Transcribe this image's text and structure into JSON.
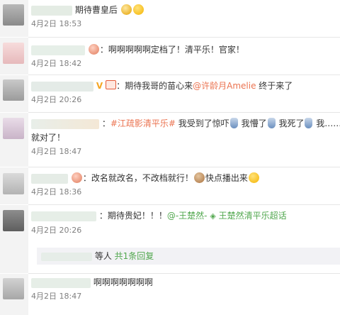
{
  "comments": [
    {
      "text": "期待曹皇后",
      "time": "4月2日 18:53"
    },
    {
      "text": "：啊啊啊啊啊定档了！清平乐！官家！",
      "time": "4月2日 18:42"
    },
    {
      "prefix": "：期待我哥的苗心来",
      "mention": "@许龄月Amelie",
      "suffix": " 终于来了",
      "time": "4月2日 20:26"
    },
    {
      "prefix": "：",
      "hashtag": "#江疏影清平乐#",
      "p1": " 我受到了惊吓",
      "p2": " 我懵了",
      "p3": " 我死了",
      "p4": " 我……",
      "line2": "就对了！",
      "time": "4月2日 18:47"
    },
    {
      "text": "：改名就改名，不改档就行！",
      "text2": "快点播出来",
      "time": "4月2日 18:36"
    },
    {
      "prefix": "：期待贵妃！！！",
      "mention": "@-王楚然-",
      "super_topic": "王楚然清平乐超话",
      "time": "4月2日 20:26"
    },
    {
      "text": "啊啊啊啊啊啊啊",
      "time": "4月2日 18:47"
    }
  ],
  "reply_summary": {
    "label": "等人",
    "link": "共1条回复"
  },
  "icons": {
    "vip_badge": "V",
    "super_topic": "diamond-icon"
  },
  "colors": {
    "link": "#eb7350",
    "time": "#808080",
    "accent_green": "#52a84f"
  }
}
